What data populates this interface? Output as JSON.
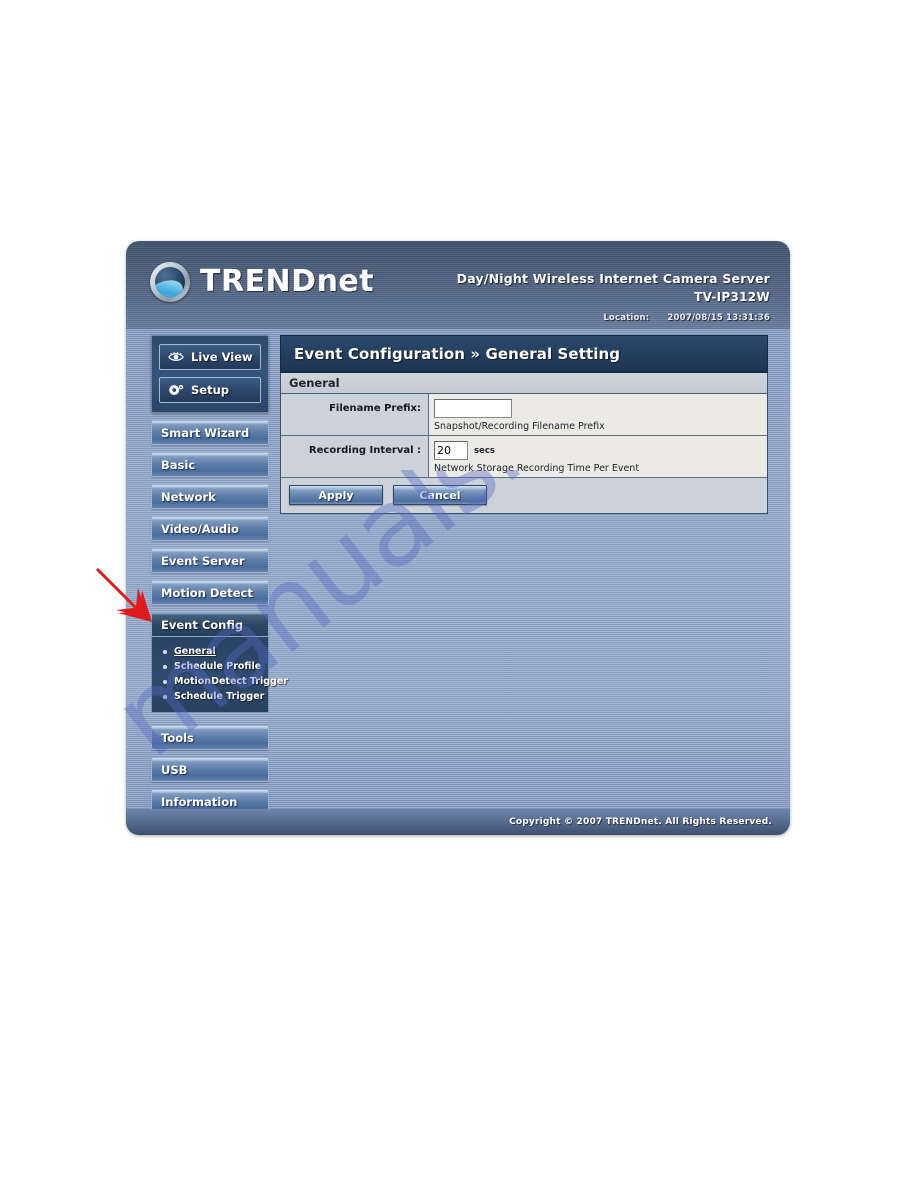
{
  "header": {
    "logo_text_main": "TREND",
    "logo_text_suffix": "net",
    "logo_icon": "trendnet-globe-logo",
    "product_title": "Day/Night Wireless Internet Camera Server",
    "product_model": "TV-IP312W",
    "location_label": "Location:",
    "timestamp": "2007/08/15 13:31:36"
  },
  "sidebar": {
    "view_buttons": [
      {
        "label": "Live View",
        "icon": "eye-icon"
      },
      {
        "label": "Setup",
        "icon": "gear-icon"
      }
    ],
    "menu_items": [
      {
        "label": "Smart Wizard",
        "active": false
      },
      {
        "label": "Basic",
        "active": false
      },
      {
        "label": "Network",
        "active": false
      },
      {
        "label": "Video/Audio",
        "active": false
      },
      {
        "label": "Event Server",
        "active": false
      },
      {
        "label": "Motion Detect",
        "active": false
      },
      {
        "label": "Event Config",
        "active": true
      }
    ],
    "submenu_items": [
      {
        "label": "General",
        "current": true
      },
      {
        "label": "Schedule Profile",
        "current": false
      },
      {
        "label": "MotionDetect Trigger",
        "current": false
      },
      {
        "label": "Schedule Trigger",
        "current": false
      }
    ],
    "menu_items_bottom": [
      {
        "label": "Tools",
        "active": false
      },
      {
        "label": "USB",
        "active": false
      },
      {
        "label": "Information",
        "active": false
      }
    ]
  },
  "main": {
    "page_title": "Event Configuration » General Setting",
    "section_title": "General",
    "fields": [
      {
        "label": "Filename Prefix:",
        "value": "",
        "unit": "",
        "hint": "Snapshot/Recording Filename Prefix"
      },
      {
        "label": "Recording Interval :",
        "value": "20",
        "unit": "secs",
        "hint": "Network Storage Recording Time Per Event"
      }
    ],
    "buttons": {
      "apply": "Apply",
      "cancel": "Cancel"
    }
  },
  "footer": {
    "copyright": "Copyright © 2007 TRENDnet. All Rights Reserved."
  },
  "annotations": {
    "arrow_color": "#e01b1b",
    "arrow_target": "Event Config"
  },
  "watermark": {
    "text": "manualshive.com",
    "color": "#5668c4"
  }
}
